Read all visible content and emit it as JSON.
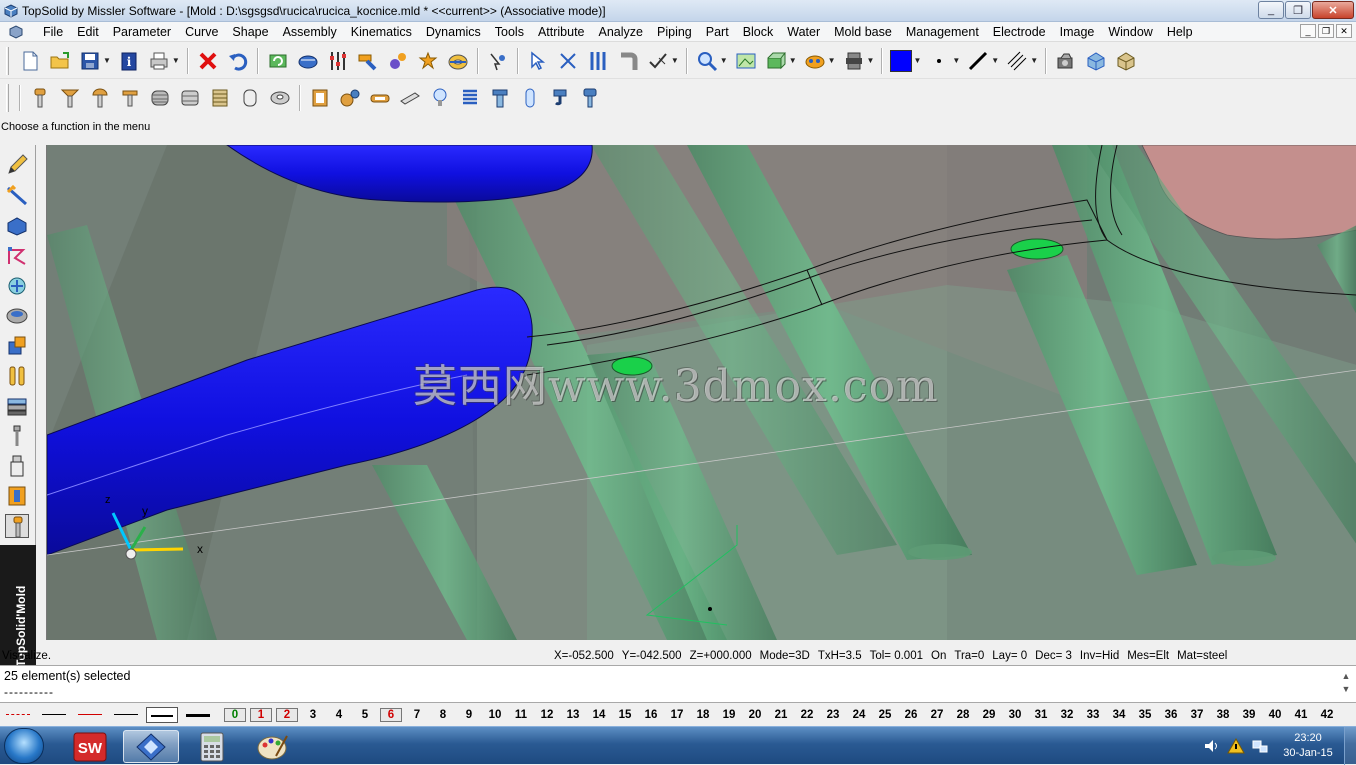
{
  "window": {
    "title": "TopSolid by Missler Software - [Mold : D:\\sgsgsd\\rucica\\rucica_kocnice.mld *  <<current>> (Associative mode)]",
    "controls": [
      "_",
      "❐",
      "✕"
    ]
  },
  "menu": {
    "items": [
      "File",
      "Edit",
      "Parameter",
      "Curve",
      "Shape",
      "Assembly",
      "Kinematics",
      "Dynamics",
      "Tools",
      "Attribute",
      "Analyze",
      "Piping",
      "Part",
      "Block",
      "Water",
      "Mold base",
      "Management",
      "Electrode",
      "Image",
      "Window",
      "Help"
    ]
  },
  "toolbar1": {
    "icons": [
      "new-file-icon",
      "open-folder-icon",
      "save-icon",
      "info-icon",
      "print-icon",
      "delete-icon",
      "undo-icon",
      "update-icon",
      "scan-icon",
      "parameters-icon",
      "hammer-icon",
      "assembly-wrench-icon",
      "torus-icon",
      "cursor-icon",
      "select-icon",
      "cut-icon",
      "equalizer-icon",
      "pipe-icon",
      "check-icon",
      "zoom-icon",
      "zoom-all-icon",
      "view-icon",
      "render-icon",
      "print-preview-icon",
      "camera-icon",
      "model-icon",
      "cube-icon"
    ],
    "current_color": "#0000ff"
  },
  "toolbar2": {
    "icons": [
      "screw-icon",
      "countersunk-screw-icon",
      "button-head-screw-icon",
      "flat-screw-icon",
      "nut-icon",
      "hex-nut-icon",
      "threaded-insert-icon",
      "cylinder-pin-icon",
      "washer-icon",
      "stack-icon",
      "gears-icon",
      "clamp-icon",
      "dowel-icon",
      "bulb-icon",
      "spring-icon",
      "bolt-icon",
      "pin-icon",
      "hook-icon",
      "ejector-icon"
    ]
  },
  "prompt": "Choose a function in the menu",
  "left_toolbar": {
    "icons": [
      "pencil-icon",
      "curve-icon",
      "shape-icon",
      "assembly-icon",
      "kinematics-icon",
      "part-icon",
      "block-icon",
      "water-icon",
      "mold-base-icon",
      "ejector-icon",
      "electrode-icon",
      "tools-icon",
      "screw-lib-icon",
      "component-icon"
    ],
    "tab_label": "TopSolid'Mold"
  },
  "viewport": {
    "watermark": "莫西网www.3dmox.com",
    "axes": {
      "x": "x",
      "y": "y",
      "z": "z"
    }
  },
  "status": {
    "left": "Visualize.",
    "fields": [
      "X=-052.500",
      "Y=-042.500",
      "Z=+000.000",
      "Mode=3D",
      "TxH=3.5",
      "Tol= 0.001",
      "On",
      "Tra=0",
      "Lay=  0",
      "Dec= 3",
      "Inv=Hid",
      "Mes=Elt",
      "Mat=steel"
    ]
  },
  "messages": {
    "line1": "25 element(s) selected",
    "line2": "----------"
  },
  "layers": {
    "boxed": [
      "0",
      "1",
      "2"
    ],
    "numbers": [
      "3",
      "4",
      "5",
      "6",
      "7",
      "8",
      "9",
      "10",
      "11",
      "12",
      "13",
      "14",
      "15",
      "16",
      "17",
      "18",
      "19",
      "20",
      "21",
      "22",
      "23",
      "24",
      "25",
      "26",
      "27",
      "28",
      "29",
      "30",
      "31",
      "32",
      "33",
      "34",
      "35",
      "36",
      "37",
      "38",
      "39",
      "40",
      "41",
      "42"
    ],
    "current": "6"
  },
  "taskbar": {
    "apps": [
      "windows-start-icon",
      "solidworks-icon",
      "topsolid-icon",
      "calculator-icon",
      "paint-icon"
    ],
    "time": "23:20",
    "date": "30-Jan-15"
  }
}
